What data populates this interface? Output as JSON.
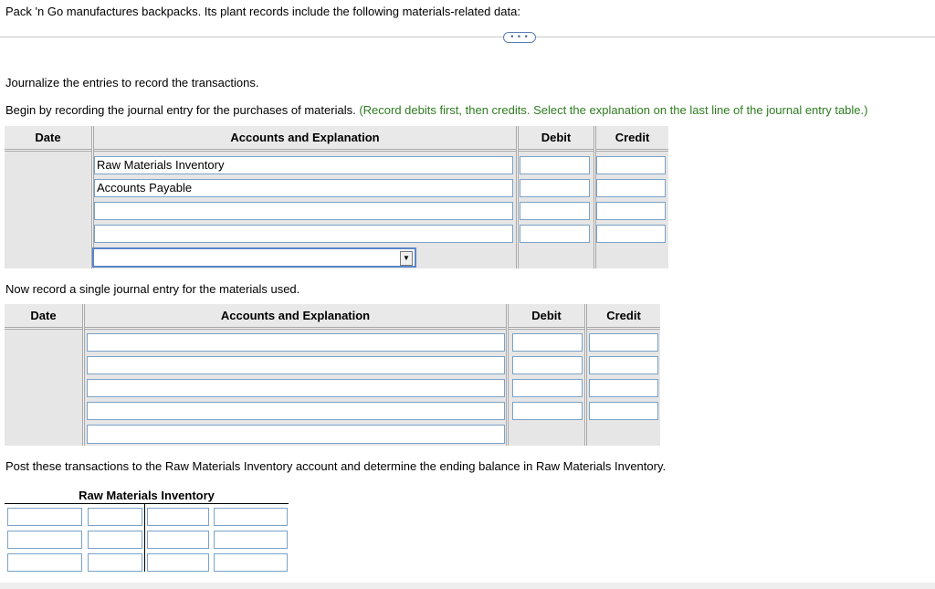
{
  "intro": "Pack 'n Go manufactures backpacks. Its plant records include the following materials-related data:",
  "more_button": "• • •",
  "instr1": "Journalize the entries to record the transactions.",
  "instr2_black": "Begin by recording the journal entry for the purchases of materials.",
  "instr2_green": "(Record debits first, then credits. Select the explanation on the last line of the journal entry table.)",
  "table1": {
    "headers": {
      "date": "Date",
      "accounts": "Accounts and Explanation",
      "debit": "Debit",
      "credit": "Credit"
    },
    "rows": [
      {
        "account": "Raw Materials Inventory",
        "debit": "",
        "credit": ""
      },
      {
        "account": "Accounts Payable",
        "debit": "",
        "credit": ""
      },
      {
        "account": "",
        "debit": "",
        "credit": ""
      },
      {
        "account": "",
        "debit": "",
        "credit": ""
      }
    ],
    "explanation_selected": ""
  },
  "instr3": "Now record a single journal entry for the materials used.",
  "table2": {
    "headers": {
      "date": "Date",
      "accounts": "Accounts and Explanation",
      "debit": "Debit",
      "credit": "Credit"
    },
    "rows": [
      {
        "account": "",
        "debit": "",
        "credit": ""
      },
      {
        "account": "",
        "debit": "",
        "credit": ""
      },
      {
        "account": "",
        "debit": "",
        "credit": ""
      },
      {
        "account": "",
        "debit": "",
        "credit": ""
      }
    ],
    "explanation": ""
  },
  "instr4": "Post these transactions to the Raw Materials Inventory account and determine the ending balance in Raw Materials Inventory.",
  "taccount": {
    "title": "Raw Materials Inventory",
    "rows": [
      [
        "",
        "",
        "",
        ""
      ],
      [
        "",
        "",
        "",
        ""
      ],
      [
        "",
        "",
        "",
        ""
      ]
    ]
  }
}
